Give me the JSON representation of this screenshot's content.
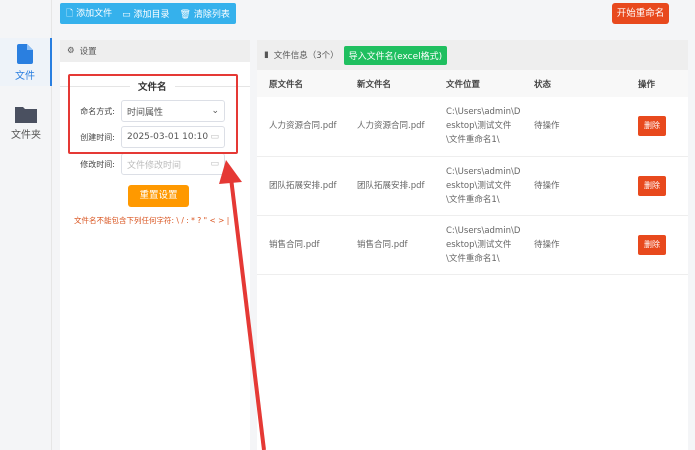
{
  "sidebar": {
    "items": [
      {
        "label": "文件",
        "icon": "file-icon",
        "active": true
      },
      {
        "label": "文件夹",
        "icon": "folder-icon"
      }
    ]
  },
  "toolbar": {
    "add_file": "添加文件",
    "add_dir": "添加目录",
    "clear": "清除列表",
    "start": "开始重命名"
  },
  "settings": {
    "title": "设置",
    "section": "文件名",
    "naming_label": "命名方式:",
    "naming_value": "时间属性",
    "created_label": "创建时间:",
    "created_value": "2025-03-01 10:10",
    "modified_label": "修改时间:",
    "modified_placeholder": "文件修改时间",
    "reset": "重置设置",
    "warning": "文件名不能包含下列任何字符: \\ / : * ? \" < > |"
  },
  "files": {
    "title": "文件信息（3个）",
    "import": "导入文件名(excel格式)",
    "columns": [
      "原文件名",
      "新文件名",
      "文件位置",
      "状态",
      "操作"
    ],
    "rows": [
      {
        "orig": "人力资源合同.pdf",
        "new": "人力资源合同.pdf",
        "path": "C:\\Users\\admin\\Desktop\\测试文件\\文件重命名1\\",
        "status": "待操作",
        "action": "删除"
      },
      {
        "orig": "团队拓展安排.pdf",
        "new": "团队拓展安排.pdf",
        "path": "C:\\Users\\admin\\Desktop\\测试文件\\文件重命名1\\",
        "status": "待操作",
        "action": "删除"
      },
      {
        "orig": "销售合同.pdf",
        "new": "销售合同.pdf",
        "path": "C:\\Users\\admin\\Desktop\\测试文件\\文件重命名1\\",
        "status": "待操作",
        "action": "删除"
      }
    ]
  },
  "colors": {
    "primary": "#2a7fe0",
    "toolbar": "#35b1ec",
    "danger": "#e8491d",
    "success": "#1fbf5f",
    "reset": "#ff9900",
    "highlight": "#e53935"
  }
}
